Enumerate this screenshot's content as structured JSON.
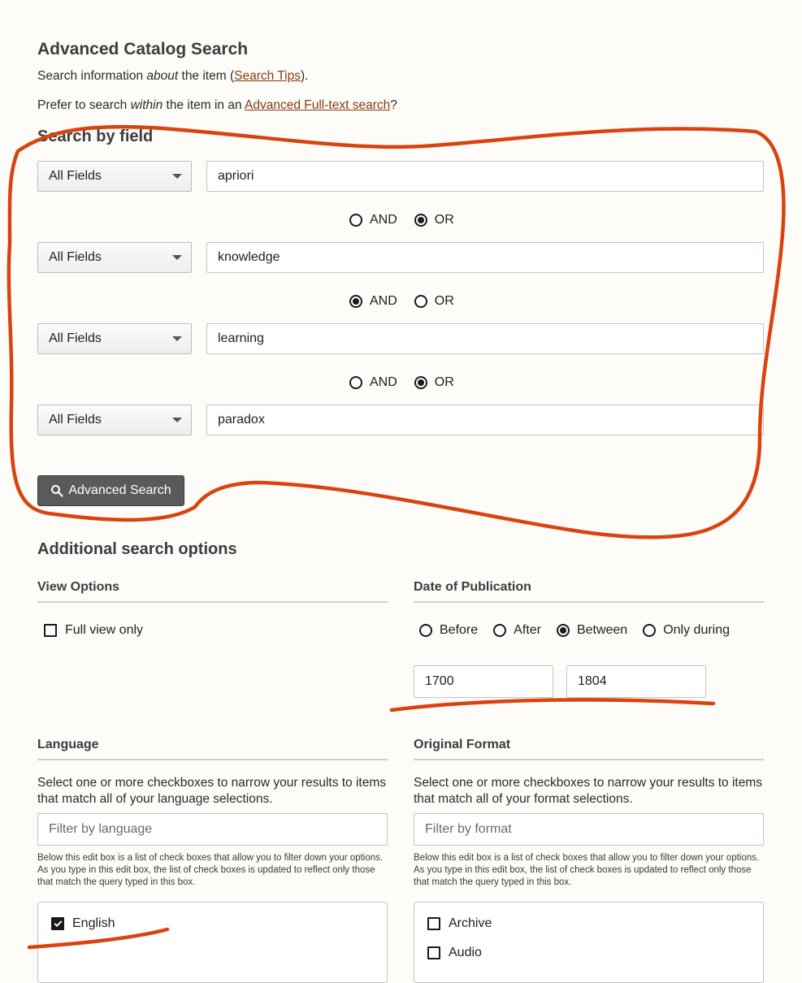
{
  "page": {
    "title": "Advanced Catalog Search",
    "intro1": {
      "pre": "Search information ",
      "em": "about",
      "mid": " the item (",
      "link": "Search Tips",
      "post": ")."
    },
    "intro2": {
      "pre": "Prefer to search ",
      "em": "within",
      "mid": " the item in an ",
      "link": "Advanced Full-text search",
      "post": "?"
    }
  },
  "search_by_field": {
    "heading": "Search by field",
    "rows": [
      {
        "field": "All Fields",
        "value": "apriori"
      },
      {
        "field": "All Fields",
        "value": "knowledge"
      },
      {
        "field": "All Fields",
        "value": "learning"
      },
      {
        "field": "All Fields",
        "value": "paradox"
      }
    ],
    "bool_labels": {
      "and": "AND",
      "or": "OR"
    },
    "bool_selected": [
      "OR",
      "AND",
      "OR"
    ],
    "submit_label": "Advanced Search"
  },
  "additional": {
    "heading": "Additional search options",
    "view_options": {
      "heading": "View Options",
      "full_view_label": "Full view only",
      "full_view_checked": false
    },
    "date": {
      "heading": "Date of Publication",
      "options": [
        "Before",
        "After",
        "Between",
        "Only during"
      ],
      "selected": "Between",
      "start": "1700",
      "end": "1804"
    },
    "language": {
      "heading": "Language",
      "description": "Select one or more checkboxes to narrow your results to items that match all of your language selections.",
      "filter_placeholder": "Filter by language",
      "help": "Below this edit box is a list of check boxes that allow you to filter down your options. As you type in this edit box, the list of check boxes is updated to reflect only those that match the query typed in this box.",
      "items": [
        {
          "label": "English",
          "checked": true
        }
      ]
    },
    "format": {
      "heading": "Original Format",
      "description": "Select one or more checkboxes to narrow your results to items that match all of your format selections.",
      "filter_placeholder": "Filter by format",
      "help": "Below this edit box is a list of check boxes that allow you to filter down your options. As you type in this edit box, the list of check boxes is updated to reflect only those that match the query typed in this box.",
      "items": [
        {
          "label": "Archive",
          "checked": false
        },
        {
          "label": "Audio",
          "checked": false
        }
      ]
    }
  },
  "colors": {
    "link": "#8a3a0c",
    "annotation": "#d9430f",
    "button": "#5a5a5a"
  }
}
